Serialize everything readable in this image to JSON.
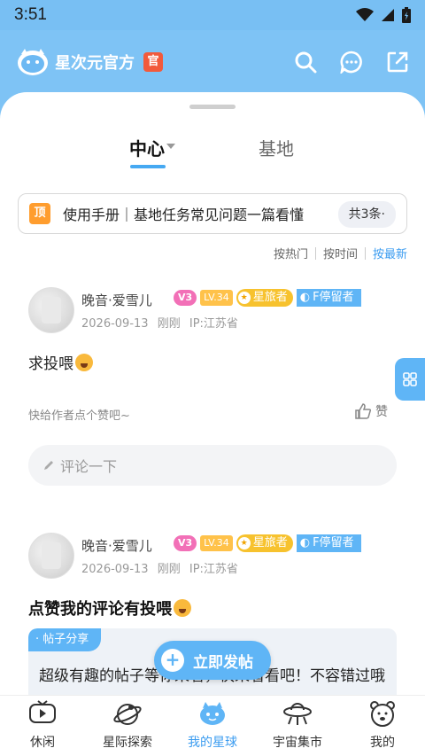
{
  "status_bar": {
    "time": "3:51"
  },
  "header": {
    "brand": "星次元官方",
    "official_badge": "官"
  },
  "tabs": {
    "center": "中心",
    "base": "基地"
  },
  "notice": {
    "tag": "顶",
    "text": "使用手册｜基地任务常见问题一篇看懂",
    "count": "共3条·"
  },
  "sort": {
    "hot": "按热门",
    "time": "按时间",
    "latest": "按最新",
    "active": "latest"
  },
  "posts": [
    {
      "user": "晚音·爱雪儿",
      "vip": "V3",
      "level": "LV.34",
      "badge_traveler": "星旅者",
      "badge_stay": "F停留者",
      "date": "2026-09-13",
      "ago": "刚刚",
      "ip": "IP:江苏省",
      "text": "求投喂",
      "hint": "快给作者点个赞吧~",
      "like_label": "赞",
      "comment_placeholder": "评论一下"
    },
    {
      "user": "晚音·爱雪儿",
      "vip": "V3",
      "level": "LV.34",
      "badge_traveler": "星旅者",
      "badge_stay": "F停留者",
      "date": "2026-09-13",
      "ago": "刚刚",
      "ip": "IP:江苏省",
      "title": "点赞我的评论有投喂",
      "share_tag": "· 帖子分享",
      "share_text": "超级有趣的帖子等你来看，快来看看吧！不容错过哦~"
    }
  ],
  "fab": {
    "label": "立即发帖"
  },
  "bottom_nav": [
    {
      "label": "休闲",
      "icon": "tv-icon"
    },
    {
      "label": "星际探索",
      "icon": "planet-explore-icon"
    },
    {
      "label": "我的星球",
      "icon": "mascot-planet-icon",
      "active": true
    },
    {
      "label": "宇宙集市",
      "icon": "ufo-icon"
    },
    {
      "label": "我的",
      "icon": "bear-profile-icon"
    }
  ],
  "colors": {
    "primary": "#5FB5F6",
    "header_bg": "#7EC3F5",
    "accent_text": "#3B9CF0"
  }
}
